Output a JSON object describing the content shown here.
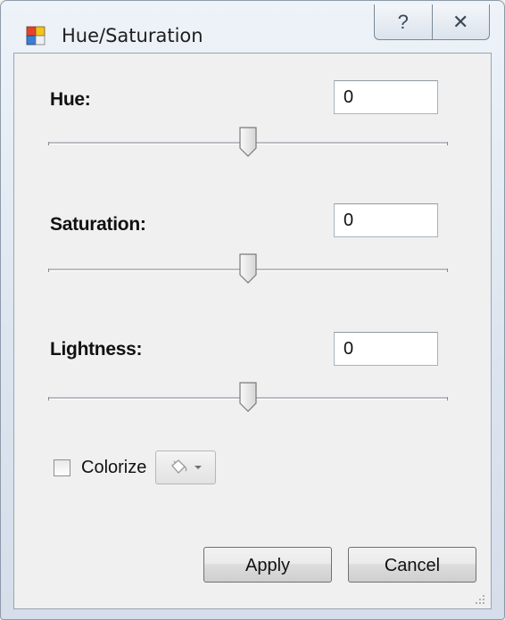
{
  "window": {
    "title": "Hue/Saturation",
    "icon": "palette-app-icon",
    "caption_buttons": [
      {
        "name": "help",
        "glyph": "?"
      },
      {
        "name": "close",
        "glyph": "✕"
      }
    ]
  },
  "hue": {
    "label": "Hue:",
    "value": "0",
    "slider_position": 0.5
  },
  "saturation": {
    "label": "Saturation:",
    "value": "0",
    "slider_position": 0.5
  },
  "lightness": {
    "label": "Lightness:",
    "value": "0",
    "slider_position": 0.5
  },
  "colorize": {
    "label": "Colorize",
    "checked": false,
    "color_button_icon": "paint-bucket-icon"
  },
  "buttons": {
    "apply": "Apply",
    "cancel": "Cancel"
  },
  "colors": {
    "client_bg": "#f0f0f0",
    "title_bg": "#dbe4ef"
  }
}
